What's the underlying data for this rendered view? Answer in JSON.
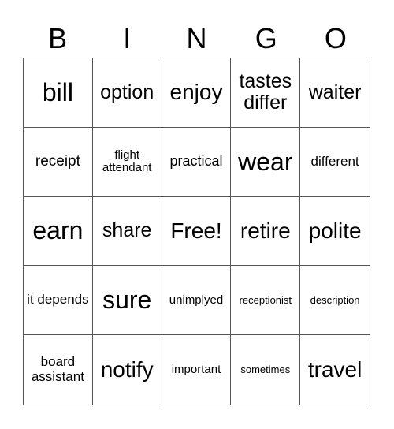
{
  "header": [
    "B",
    "I",
    "N",
    "G",
    "O"
  ],
  "cells": [
    [
      "bill",
      "option",
      "enjoy",
      "tastes differ",
      "waiter"
    ],
    [
      "receipt",
      "flight attendant",
      "practical",
      "wear",
      "different"
    ],
    [
      "earn",
      "share",
      "Free!",
      "retire",
      "polite"
    ],
    [
      "it depends",
      "sure",
      "unimplyed",
      "receptionist",
      "description"
    ],
    [
      "board assistant",
      "notify",
      "important",
      "sometimes",
      "travel"
    ]
  ]
}
